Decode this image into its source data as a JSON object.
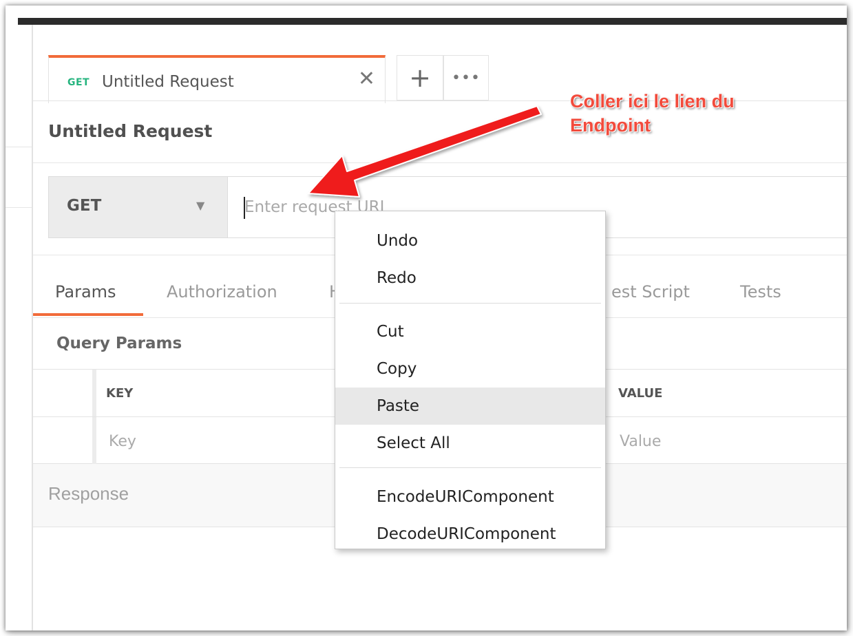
{
  "tab": {
    "method": "GET",
    "title": "Untitled Request",
    "close_glyph": "✕",
    "add_glyph": "+",
    "more_glyph": "•••"
  },
  "request": {
    "title": "Untitled Request",
    "method": "GET",
    "method_caret": "▼",
    "url_placeholder": "Enter request URL",
    "url_value": ""
  },
  "sections": {
    "tabs": [
      {
        "label": "Params",
        "active": true
      },
      {
        "label": "Authorization",
        "active": false
      },
      {
        "label": "H",
        "active": false
      },
      {
        "label": "est Script",
        "active": false
      },
      {
        "label": "Tests",
        "active": false
      }
    ]
  },
  "query_params": {
    "title": "Query Params",
    "columns": {
      "key": "KEY",
      "value": "VALUE"
    },
    "row_placeholders": {
      "key": "Key",
      "value": "Value"
    }
  },
  "response": {
    "label": "Response"
  },
  "context_menu": {
    "items": [
      {
        "label": "Undo",
        "highlighted": false
      },
      {
        "label": "Redo",
        "highlighted": false
      },
      {
        "label": "Cut",
        "highlighted": false
      },
      {
        "label": "Copy",
        "highlighted": false
      },
      {
        "label": "Paste",
        "highlighted": true
      },
      {
        "label": "Select All",
        "highlighted": false
      },
      {
        "label": "EncodeURIComponent",
        "highlighted": false
      },
      {
        "label": "DecodeURIComponent",
        "highlighted": false
      }
    ]
  },
  "annotation": {
    "line1": "Coller ici le lien du",
    "line2": "Endpoint",
    "color": "#f24b3c"
  },
  "colors": {
    "accent": "#f26b3a",
    "get_method": "#26b47f",
    "top_bar": "#2b2b2b"
  },
  "icons": {
    "close": "close-icon",
    "add": "plus-icon",
    "more": "ellipsis-icon",
    "caret": "chevron-down-icon",
    "arrow": "arrow-annotation-icon"
  }
}
